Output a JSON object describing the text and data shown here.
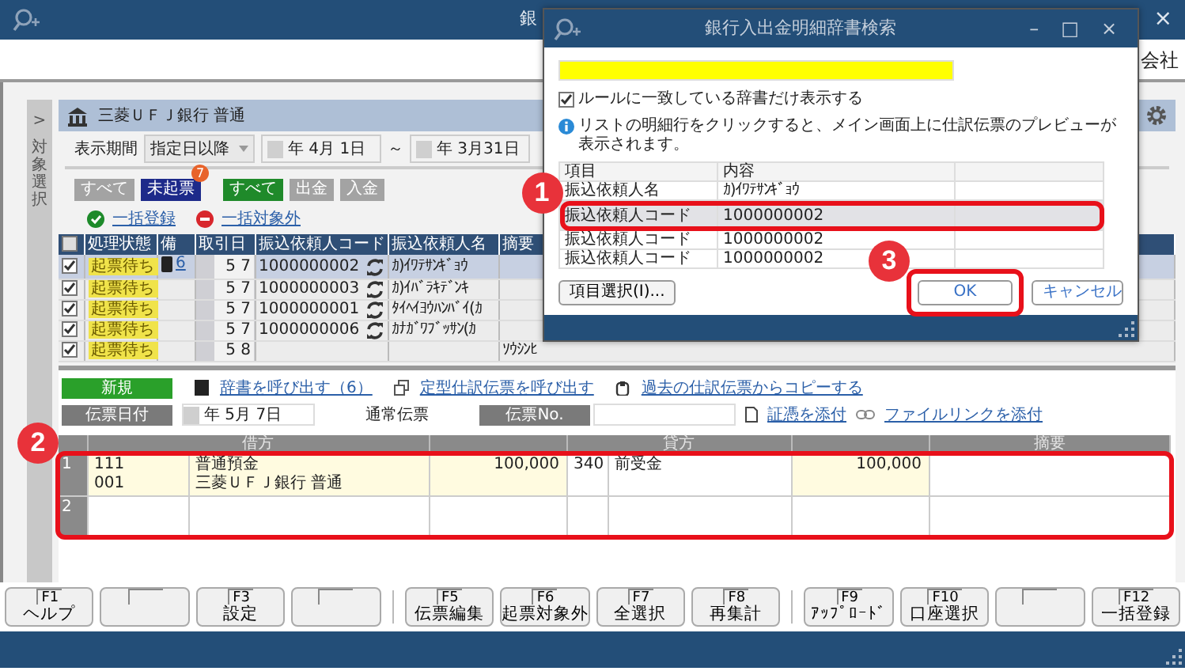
{
  "app": {
    "title": "銀",
    "company": "会社",
    "close": "×"
  },
  "sidebar": {
    "toggle": ">",
    "label": "対象選択"
  },
  "account": {
    "name": "三菱ＵＦＪ銀行 普通"
  },
  "period": {
    "label": "表示期間",
    "mode": "指定日以降",
    "from": "年 4月 1日",
    "tilde": "～",
    "to": "年 3月31日"
  },
  "filters": [
    {
      "kind": "status",
      "label": "すべて",
      "selected": false
    },
    {
      "kind": "status",
      "label": "未起票",
      "selected": true,
      "badge": "7"
    },
    {
      "kind": "direction",
      "label": "すべて",
      "selected": true
    },
    {
      "kind": "direction",
      "label": "出金",
      "selected": false
    },
    {
      "kind": "direction",
      "label": "入金",
      "selected": false
    }
  ],
  "bulk_actions": [
    {
      "kind": "register",
      "label": "一括登録"
    },
    {
      "kind": "exclude",
      "label": "一括対象外"
    }
  ],
  "transactions": {
    "select_all_checked": false,
    "columns": [
      "処理状態",
      "備",
      "取引日",
      "振込依頼人コード",
      "振込依頼人名",
      "摘要"
    ],
    "rows": [
      {
        "checked": true,
        "selected": true,
        "status": "起票待ち",
        "dictionaries": "6",
        "month": "5",
        "day": "7",
        "code": "1000000002",
        "name": "ｶ)ｲﾜﾃｻﾝｷﾞｮｳ"
      },
      {
        "checked": true,
        "selected": false,
        "status": "起票待ち",
        "month": "5",
        "day": "7",
        "code": "1000000003",
        "name": "ｶ)ｲﾊﾞﾗｷﾃﾞﾝｷ"
      },
      {
        "checked": true,
        "selected": false,
        "status": "起票待ち",
        "month": "5",
        "day": "7",
        "code": "1000000001",
        "name": "ﾀｲﾍｲﾖｳﾊﾝﾊﾞｲ(ｶ"
      },
      {
        "checked": true,
        "selected": false,
        "status": "起票待ち",
        "month": "5",
        "day": "7",
        "code": "1000000006",
        "name": "ｶﾅｶﾞﾜﾌﾞｯｻﾝ(ｶ"
      },
      {
        "checked": true,
        "selected": false,
        "status": "起票待ち",
        "month": "5",
        "day": "8",
        "memo": "ｿｳｼﾝﾋ"
      }
    ]
  },
  "voucher": {
    "mode": "新規",
    "links": [
      "辞書を呼び出す（6）",
      "定型仕訳伝票を呼び出す",
      "過去の仕訳伝票からコピーする"
    ],
    "date_label": "伝票日付",
    "date": "年 5月 7日",
    "type": "通常伝票",
    "number_label": "伝票No.",
    "attach": [
      "証憑を添付",
      "ファイルリンクを添付"
    ]
  },
  "journal": {
    "columns": [
      "借方",
      "貸方",
      "摘要"
    ],
    "rows": [
      {
        "no": "1",
        "debit_code": "111",
        "debit_account": "普通預金",
        "debit_sub_code": "001",
        "debit_sub": "三菱ＵＦＪ銀行 普通",
        "debit_amount": "100,000",
        "credit_code": "340",
        "credit_account": "前受金",
        "credit_amount": "100,000"
      },
      {
        "no": "2"
      }
    ]
  },
  "function_keys": [
    {
      "key": "F1",
      "label": "ヘルプ"
    },
    {
      "kind": "blank"
    },
    {
      "key": "F3",
      "label": "設定"
    },
    {
      "kind": "blank"
    },
    {
      "key": "F5",
      "label": "伝票編集"
    },
    {
      "key": "F6",
      "label": "起票対象外"
    },
    {
      "key": "F7",
      "label": "全選択"
    },
    {
      "key": "F8",
      "label": "再集計"
    },
    {
      "key": "F9",
      "label": "ｱｯﾌﾟﾛｰﾄﾞ"
    },
    {
      "key": "F10",
      "label": "口座選択"
    },
    {
      "kind": "blank"
    },
    {
      "key": "F12",
      "label": "一括登録"
    }
  ],
  "dialog": {
    "title": "銀行入出金明細辞書検索",
    "controls": [
      "–",
      "□",
      "×"
    ],
    "rule_filter": {
      "label": "ルールに一致している辞書だけ表示する",
      "checked": true
    },
    "info": "リストの明細行をクリックすると、メイン画面上に仕訳伝票のプレビューが表示されます。",
    "columns": [
      "項目",
      "内容"
    ],
    "rows": [
      {
        "item": "振込依頼人名",
        "value": "ｶ)ｲﾜﾃｻﾝｷﾞｮｳ",
        "selected": false
      },
      {
        "item": "振込依頼人コード",
        "value": "1000000002",
        "selected": true
      },
      {
        "item": "振込依頼人コード",
        "value": "1000000002",
        "selected": false
      },
      {
        "item": "振込依頼人コード",
        "value": "1000000002",
        "selected": false
      }
    ],
    "buttons": [
      "項目選択(I)...",
      "OK",
      "キャンセル"
    ]
  },
  "callouts": [
    "1",
    "2",
    "3"
  ]
}
